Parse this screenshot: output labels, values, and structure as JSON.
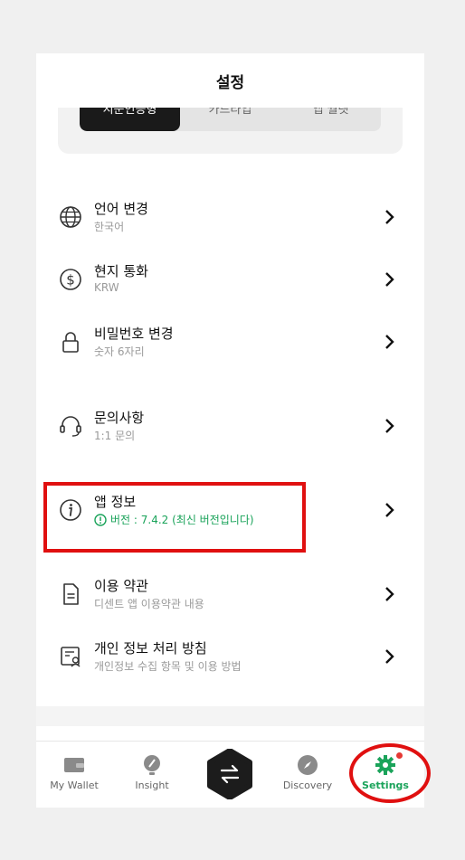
{
  "header": {
    "title": "설정"
  },
  "segments": [
    {
      "label": "지문인증형",
      "active": true
    },
    {
      "label": "카드타입",
      "active": false
    },
    {
      "label": "앱 월렛",
      "active": false
    }
  ],
  "settings": [
    {
      "title": "언어 변경",
      "sub": "한국어",
      "icon": "globe-icon"
    },
    {
      "title": "현지 통화",
      "sub": "KRW",
      "icon": "dollar-circle-icon"
    },
    {
      "title": "비밀번호 변경",
      "sub": "숫자 6자리",
      "icon": "lock-icon"
    },
    {
      "title": "문의사항",
      "sub": "1:1 문의",
      "icon": "headset-icon"
    },
    {
      "title": "앱 정보",
      "sub": "버전 : 7.4.2 (최신 버전입니다)",
      "icon": "info-icon"
    },
    {
      "title": "이용 약관",
      "sub": "디센트 앱 이용약관 내용",
      "icon": "document-icon"
    },
    {
      "title": "개인 정보 처리 방침",
      "sub": "개인정보 수집 항목 및 이용 방법",
      "icon": "privacy-document-icon"
    }
  ],
  "tabs": [
    {
      "label": "My Wallet",
      "icon": "wallet-icon"
    },
    {
      "label": "Insight",
      "icon": "lightbulb-icon"
    },
    {
      "label": "Discovery",
      "icon": "compass-icon"
    },
    {
      "label": "Settings",
      "icon": "gear-icon",
      "active": true
    }
  ],
  "colors": {
    "accent_green": "#1aa35a",
    "highlight_red": "#e01010",
    "notification_dot": "#e53935"
  }
}
